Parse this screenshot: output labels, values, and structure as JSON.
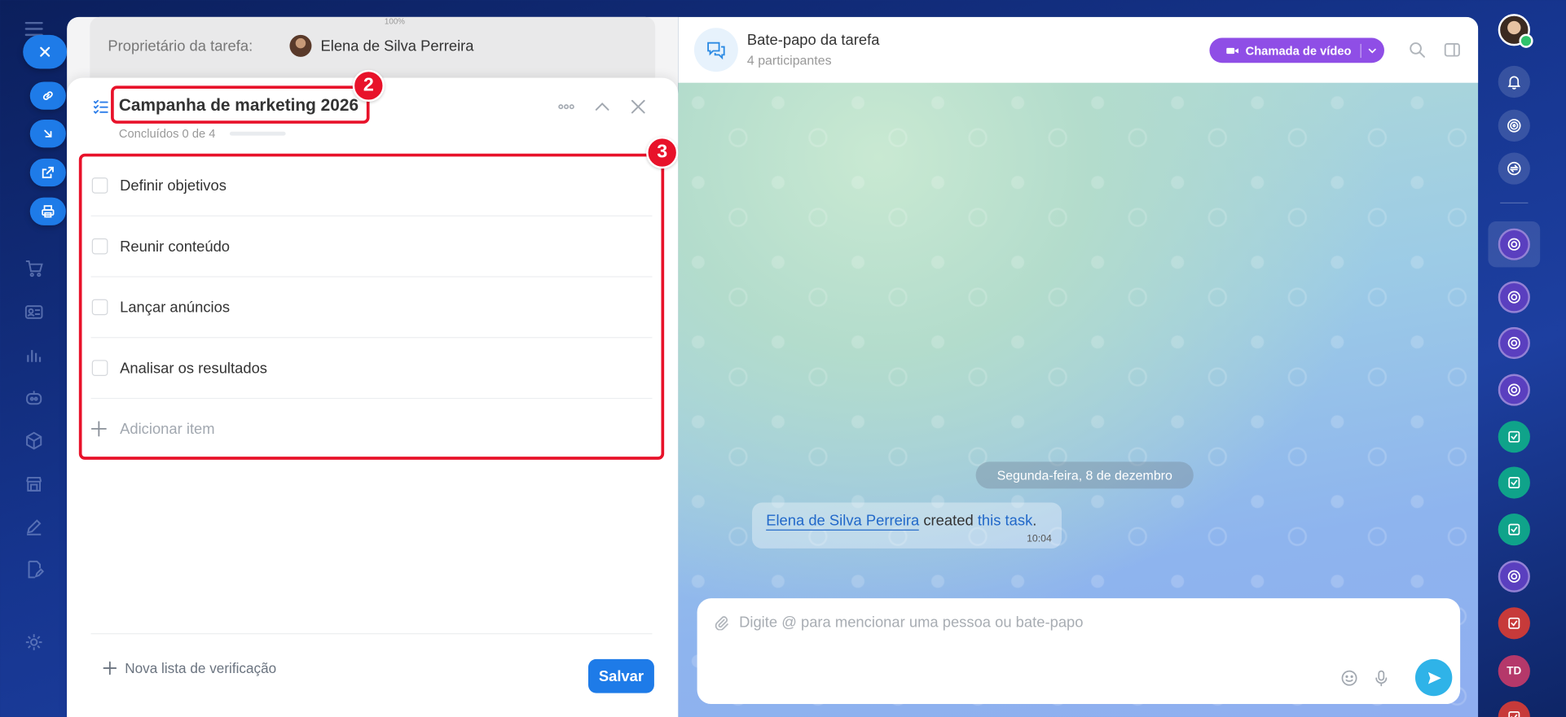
{
  "task": {
    "owner_label": "Proprietário da tarefa:",
    "owner_name": "Elena de Silva Perreira",
    "zoom": "100%"
  },
  "checklist": {
    "title": "Campanha de marketing 2026",
    "progress_text": "Concluídos 0 de 4",
    "progress_fraction": 0,
    "items": [
      {
        "label": "Definir objetivos",
        "checked": false
      },
      {
        "label": "Reunir conteúdo",
        "checked": false
      },
      {
        "label": "Lançar anúncios",
        "checked": false
      },
      {
        "label": "Analisar os resultados",
        "checked": false
      }
    ],
    "add_item_label": "Adicionar item",
    "new_checklist_label": "Nova lista de verificação",
    "save_label": "Salvar"
  },
  "annotations": {
    "badge_title": "2",
    "badge_items": "3",
    "color": "#e8122a"
  },
  "chat": {
    "title": "Bate-papo da tarefa",
    "participants": "4 participantes",
    "video_call_label": "Chamada de vídeo",
    "date_chip": "Segunda-feira, 8 de dezembro",
    "message": {
      "author": "Elena de Silva Perreira",
      "verb": "created",
      "link": "this task",
      "end": ".",
      "time": "10:04"
    },
    "composer_placeholder": "Digite @ para mencionar uma pessoa ou bate-papo"
  },
  "right_sidebar": {
    "td_initials": "TD"
  },
  "colors": {
    "accent": "#1e7be8",
    "video_button": "#8f4ee6",
    "send_button": "#2fb3e8",
    "link": "#2168c9"
  }
}
